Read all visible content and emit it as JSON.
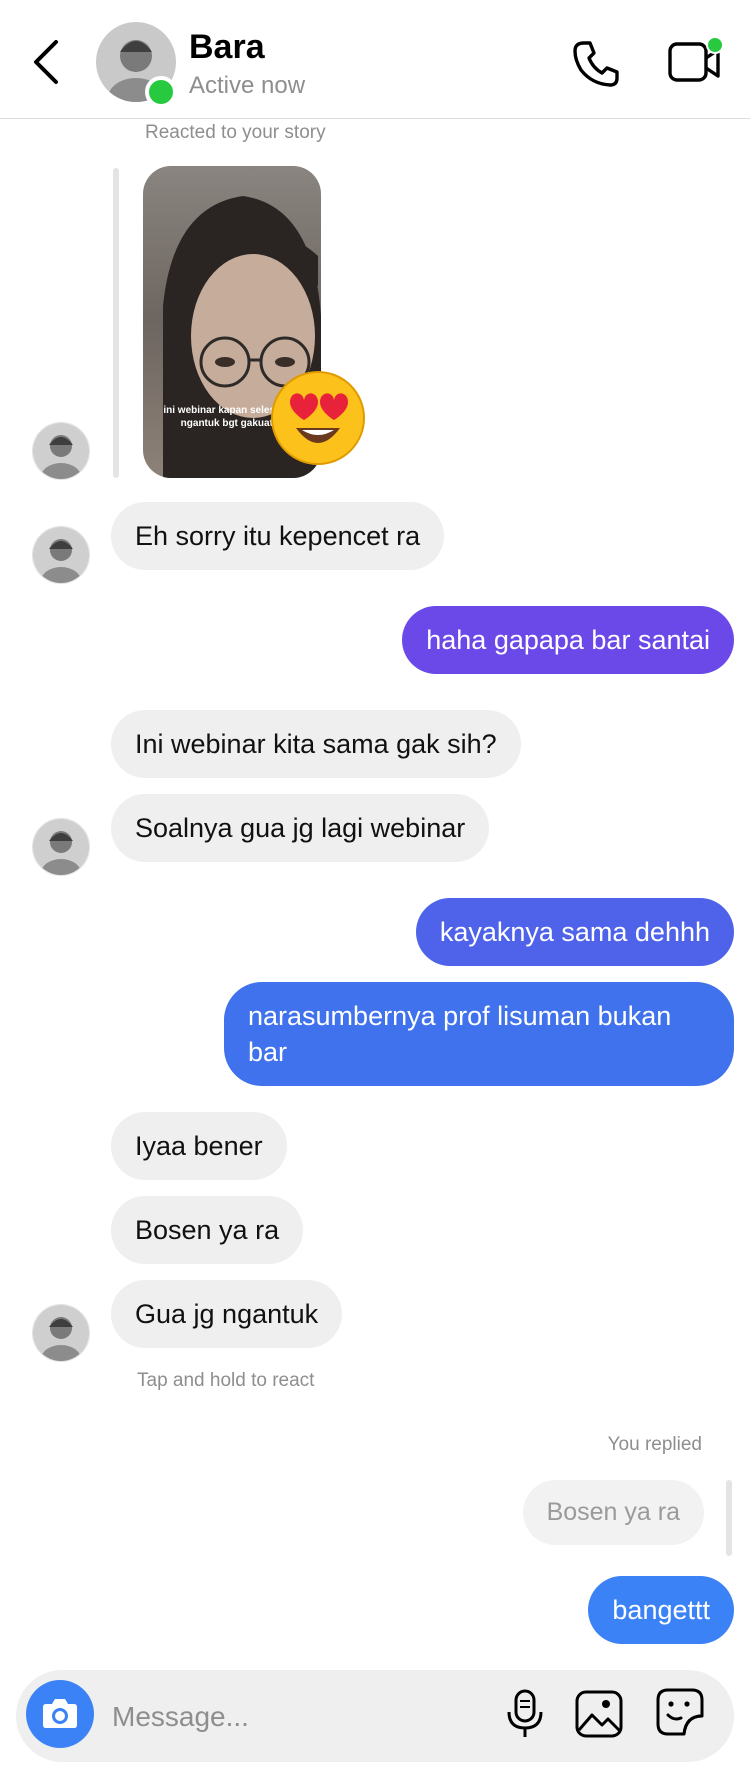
{
  "header": {
    "name": "Bara",
    "status": "Active now"
  },
  "story": {
    "label": "Reacted to your story",
    "caption": "ini webinar kapan selesainya ngantuk bgt gakuat😩",
    "reaction": "heart-eyes-emoji"
  },
  "messages": [
    {
      "from": "them",
      "text": "Eh sorry itu kepencet ra"
    },
    {
      "from": "me",
      "text": "haha gapapa bar santai"
    },
    {
      "from": "them",
      "text": "Ini webinar kita sama gak sih?"
    },
    {
      "from": "them",
      "text": "Soalnya gua jg lagi webinar"
    },
    {
      "from": "me",
      "text": "kayaknya sama dehhh"
    },
    {
      "from": "me",
      "text": "narasumbernya prof lisuman bukan bar"
    },
    {
      "from": "them",
      "text": "Iyaa bener"
    },
    {
      "from": "them",
      "text": "Bosen ya ra"
    },
    {
      "from": "them",
      "text": "Gua jg ngantuk"
    },
    {
      "from": "me",
      "text": "bangettt"
    }
  ],
  "hint": "Tap and hold to react",
  "reply": {
    "label": "You replied",
    "quoted": "Bosen ya ra"
  },
  "composer": {
    "placeholder": "Message..."
  },
  "colors": {
    "gradient_top": "#7047e8",
    "gradient_mid": "#4f63ea",
    "gradient_bottom": "#3b82f6",
    "online": "#27c93f",
    "incoming_bg": "#efefef"
  }
}
